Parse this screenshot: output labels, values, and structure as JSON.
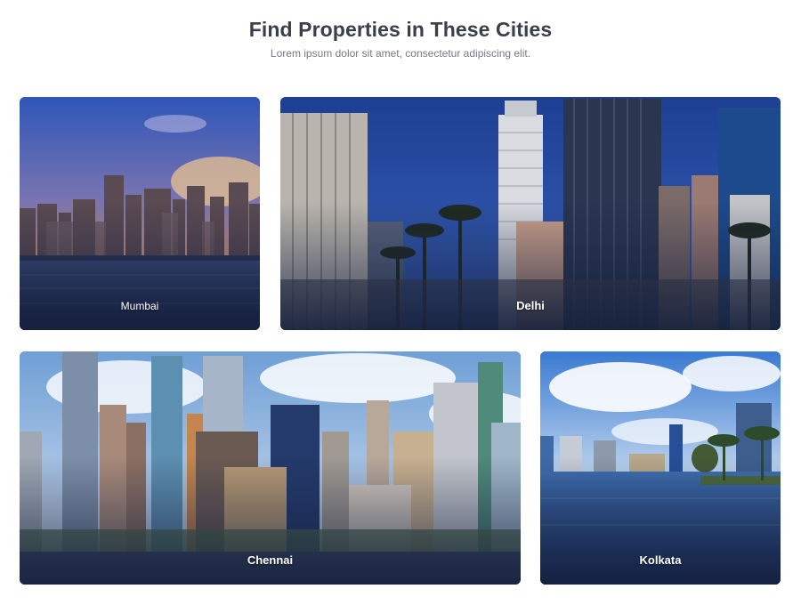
{
  "section": {
    "title": "Find Properties in These Cities",
    "subtitle": "Lorem ipsum dolor sit amet, consectetur adipiscing elit."
  },
  "cities": [
    {
      "name": "Mumbai"
    },
    {
      "name": "Delhi"
    },
    {
      "name": "Chennai"
    },
    {
      "name": "Kolkata"
    }
  ],
  "colors": {
    "heading": "#3b3f4a",
    "subtitle": "#777b85",
    "label": "#ffffff"
  }
}
